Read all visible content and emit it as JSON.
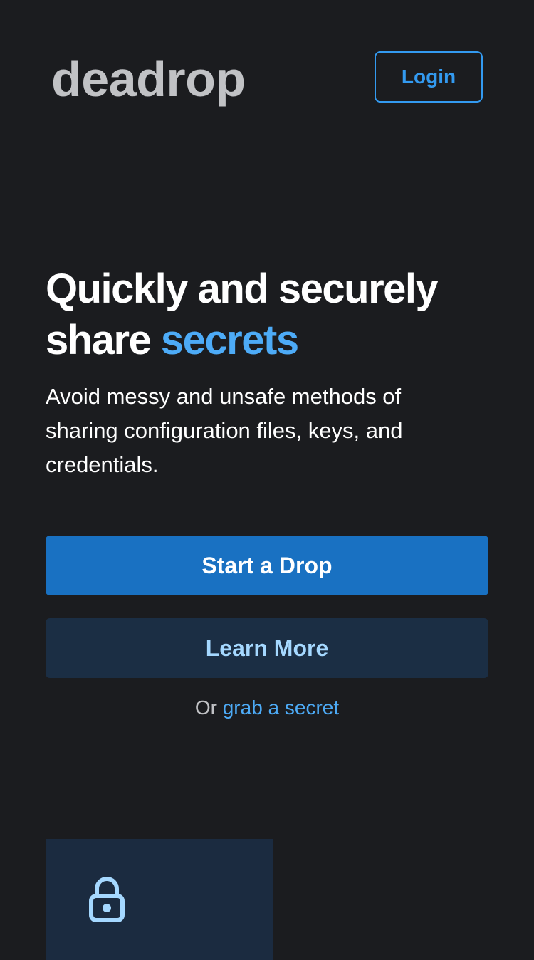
{
  "header": {
    "logo_text": "deadrop",
    "login_label": "Login"
  },
  "hero": {
    "title_line1": "Quickly and securely",
    "title_prefix": "share",
    "title_accent": "secrets",
    "description": "Avoid messy and unsafe methods of sharing configuration files, keys, and credentials."
  },
  "actions": {
    "primary_label": "Start a Drop",
    "secondary_label": "Learn More",
    "alt_prefix": "Or",
    "alt_link": "grab a secret"
  },
  "feature": {
    "icon": "lock-icon"
  },
  "colors": {
    "background": "#1b1c1f",
    "accent": "#339af0",
    "primary_button": "#1971c2",
    "secondary_button": "#1b2e44",
    "card": "#1b2b40"
  }
}
